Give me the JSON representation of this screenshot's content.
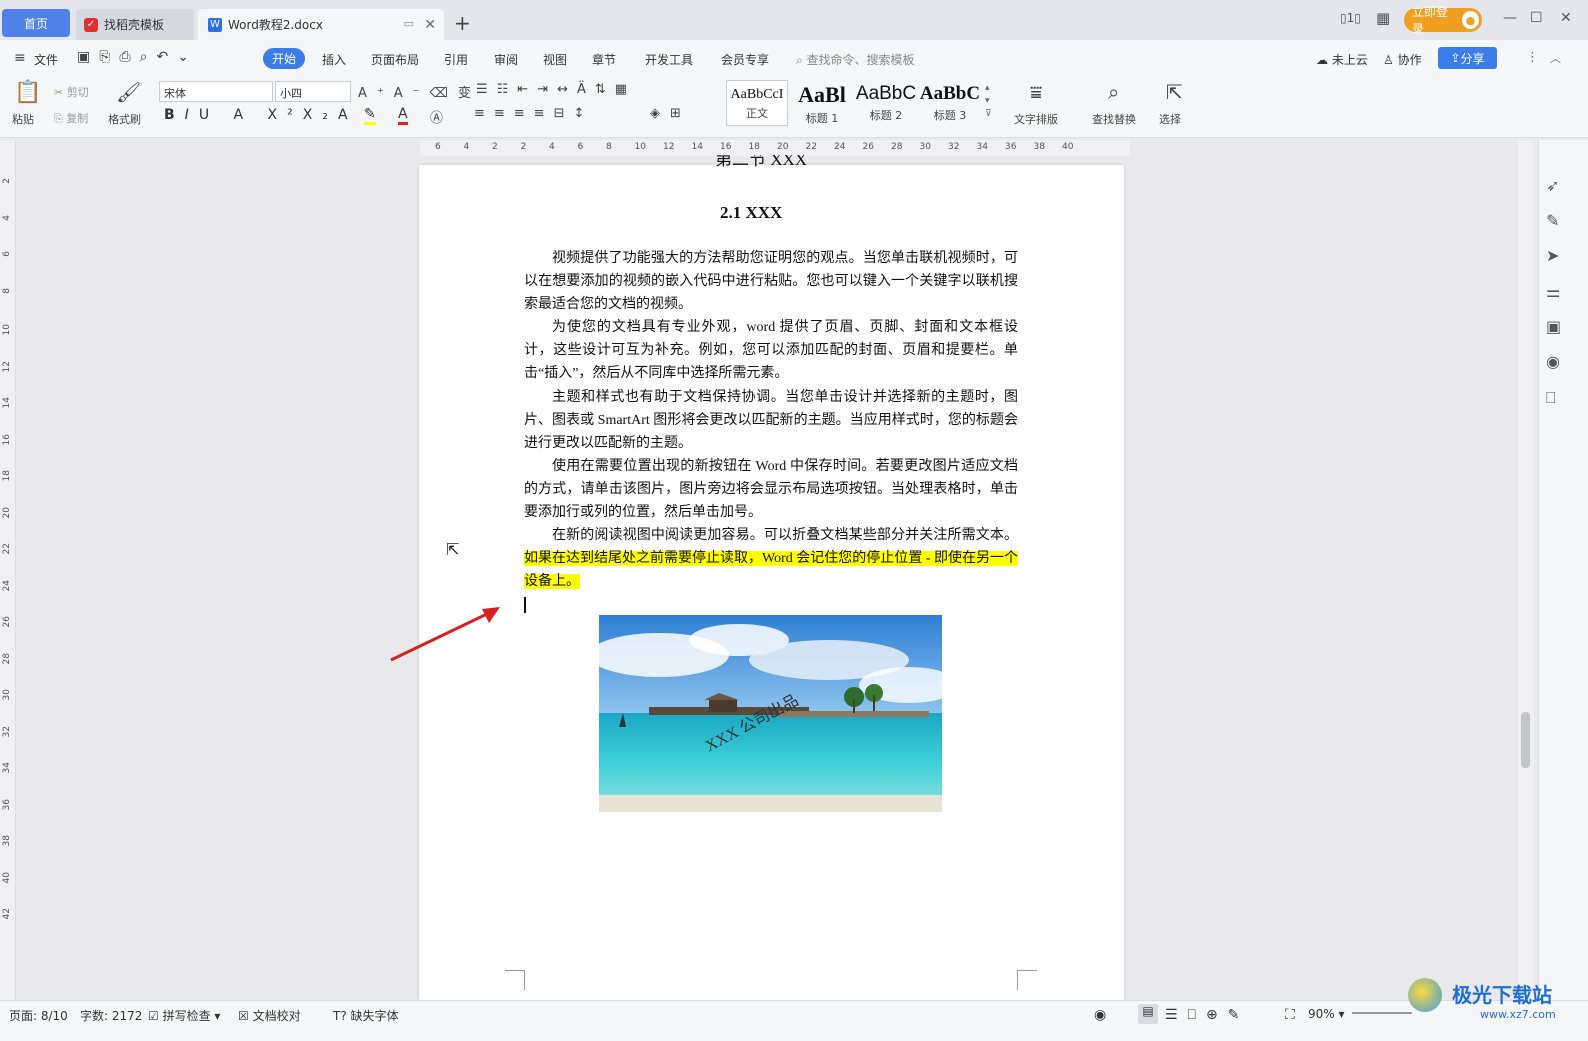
{
  "tabs": {
    "home": "首页",
    "template": "找稻壳模板",
    "document": "Word教程2.docx"
  },
  "titlebar": {
    "login": "立即登录"
  },
  "menubar": {
    "file": "文件",
    "items": [
      "开始",
      "插入",
      "页面布局",
      "引用",
      "审阅",
      "视图",
      "章节",
      "开发工具",
      "会员专享"
    ],
    "search": "查找命令、搜索模板",
    "cloud": "未上云",
    "collab": "协作",
    "share": "分享"
  },
  "ribbon": {
    "paste": "粘贴",
    "cut": "剪切",
    "copy": "复制",
    "format_painter": "格式刷",
    "font_name": "宋体",
    "font_size": "小四",
    "styles": [
      {
        "sample": "AaBbCcI",
        "name": "正文"
      },
      {
        "sample": "AaBl",
        "name": "标题 1"
      },
      {
        "sample": "AaBbC",
        "name": "标题 2"
      },
      {
        "sample": "AaBbC",
        "name": "标题 3"
      }
    ],
    "text_layout": "文字排版",
    "find_replace": "查找替换",
    "select": "选择"
  },
  "ruler": {
    "h_ticks": [
      "6",
      "4",
      "2",
      "2",
      "4",
      "6",
      "8",
      "10",
      "12",
      "14",
      "16",
      "18",
      "20",
      "22",
      "24",
      "26",
      "28",
      "30",
      "32",
      "34",
      "36",
      "38",
      "40"
    ],
    "v_ticks": [
      "2",
      "4",
      "6",
      "8",
      "10",
      "12",
      "14",
      "16",
      "18",
      "20",
      "22",
      "24",
      "26",
      "28",
      "30",
      "32",
      "34",
      "36",
      "38",
      "40",
      "42"
    ]
  },
  "document": {
    "chapter_partial": "第二节 XXX",
    "heading": "2.1 XXX",
    "paragraphs": [
      "视频提供了功能强大的方法帮助您证明您的观点。当您单击联机视频时，可以在想要添加的视频的嵌入代码中进行粘贴。您也可以键入一个关键字以联机搜索最适合您的文档的视频。",
      "为使您的文档具有专业外观，word 提供了页眉、页脚、封面和文本框设计，这些设计可互为补充。例如，您可以添加匹配的封面、页眉和提要栏。单击“插入”，然后从不同库中选择所需元素。",
      "主题和样式也有助于文档保持协调。当您单击设计并选择新的主题时，图片、图表或 SmartArt 图形将会更改以匹配新的主题。当应用样式时，您的标题会进行更改以匹配新的主题。",
      "使用在需要位置出现的新按钮在 Word 中保存时间。若要更改图片适应文档的方式，请单击该图片，图片旁边将会显示布局选项按钮。当处理表格时，单击要添加行或列的位置，然后单击加号。"
    ],
    "last_para_plain": "在新的阅读视图中阅读更加容易。可以折叠文档某些部分并关注所需文本。",
    "last_para_highlight": "如果在达到结尾处之前需要停止读取，Word 会记住您的停止位置 - 即使在另一个设备上。",
    "image_watermark": "XXX 公司出品"
  },
  "statusbar": {
    "page": "页面: 8/10",
    "words": "字数: 2172",
    "spell": "拼写检查",
    "proof": "文档校对",
    "missing_font": "缺失字体",
    "zoom": "90%"
  },
  "site_watermark": "极光下载站",
  "site_url": "www.xz7.com",
  "colors": {
    "accent": "#3b7ce8",
    "highlight": "#ffff00",
    "login": "#f0a020",
    "arrow": "#d42020"
  }
}
